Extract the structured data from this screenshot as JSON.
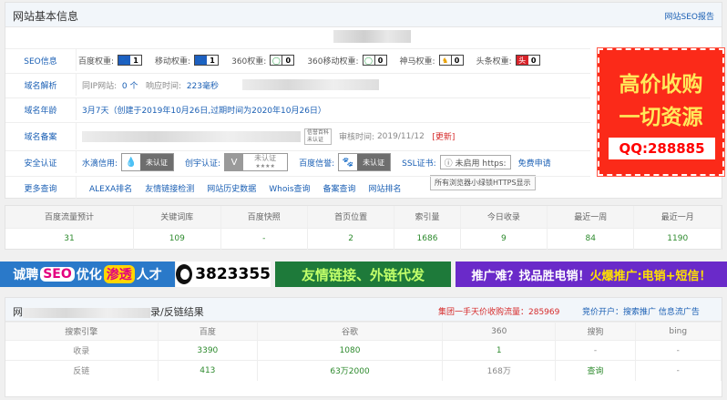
{
  "basic": {
    "title": "网站基本信息",
    "seo_report": "网站SEO报告",
    "rows": {
      "seo": {
        "label": "SEO信息",
        "baidu": "百度权重:",
        "baidu_v": "1",
        "mobile": "移动权重:",
        "mobile_v": "1",
        "s360": "360权重:",
        "s360_v": "0",
        "m360": "360移动权重:",
        "m360_v": "0",
        "shenma": "神马权重:",
        "shenma_v": "0",
        "toutiao": "头条权重:",
        "toutiao_v": "0"
      },
      "dns": {
        "label": "域名解析",
        "sameip": "同IP网站:",
        "sameip_v": "0 个",
        "resp": "响应时间:",
        "resp_v": "223毫秒"
      },
      "age": {
        "label": "域名年龄",
        "text": "3月7天（创建于2019年10月26日,过期时间为2020年10月26日）"
      },
      "icp": {
        "label": "域名备案",
        "audit": "审核时间:",
        "audit_v": "2019/11/12",
        "update": "[更新]",
        "badge_top": "信誉百科",
        "badge_bottom": "未认证"
      },
      "security": {
        "label": "安全认证",
        "drop": "水滴信用:",
        "drop_badge": "未认证",
        "chuangyu": "创宇认证:",
        "chuangyu_badge": "未认证",
        "chuangyu_sub": "★★★★",
        "baidu": "百度信誉:",
        "baidu_badge": "未认证",
        "ssl": "SSL证书:",
        "ssl_btn": "未启用 https:",
        "ssl_apply": "免费申请",
        "tooltip": "所有浏览器小绿锁HTTPS显示"
      },
      "more": {
        "label": "更多查询",
        "links": [
          "ALEXA排名",
          "友情链接检测",
          "网站历史数据",
          "Whois查询",
          "备案查询",
          "网站排名"
        ]
      }
    },
    "ad": {
      "line1": "高价收购",
      "line2": "一切资源",
      "qq": "QQ:288885"
    }
  },
  "stats": {
    "headers": [
      "百度流量预计",
      "关键词库",
      "百度快照",
      "首页位置",
      "索引量",
      "今日收录",
      "最近一周",
      "最近一月"
    ],
    "values": [
      "31",
      "109",
      "-",
      "2",
      "1686",
      "9",
      "84",
      "1190"
    ]
  },
  "banners": {
    "b1": {
      "a": "诚聘",
      "b": "SEO",
      "c": "优化",
      "d": "渗透",
      "e": "人才"
    },
    "b2": {
      "text": "3823355"
    },
    "b3": {
      "text": "友情链接、外链代发"
    },
    "b4": {
      "a": "推广难？找品胜电销！",
      "b": "火爆推广:电销+短信！"
    }
  },
  "backlinks": {
    "title": "网",
    "title_suffix": "录/反链结果",
    "ad": "集团一手天价收购流量：285969",
    "ad2": "竞价开户：搜索推广 信息流广告",
    "headers": [
      "搜索引擎",
      "百度",
      "谷歌",
      "360",
      "搜狗",
      "bing"
    ],
    "rows": [
      [
        "收录",
        "3390",
        "1080",
        "1",
        "-",
        "-"
      ],
      [
        "反链",
        "413",
        "63万2000",
        "168万",
        "查询",
        "-"
      ]
    ]
  }
}
